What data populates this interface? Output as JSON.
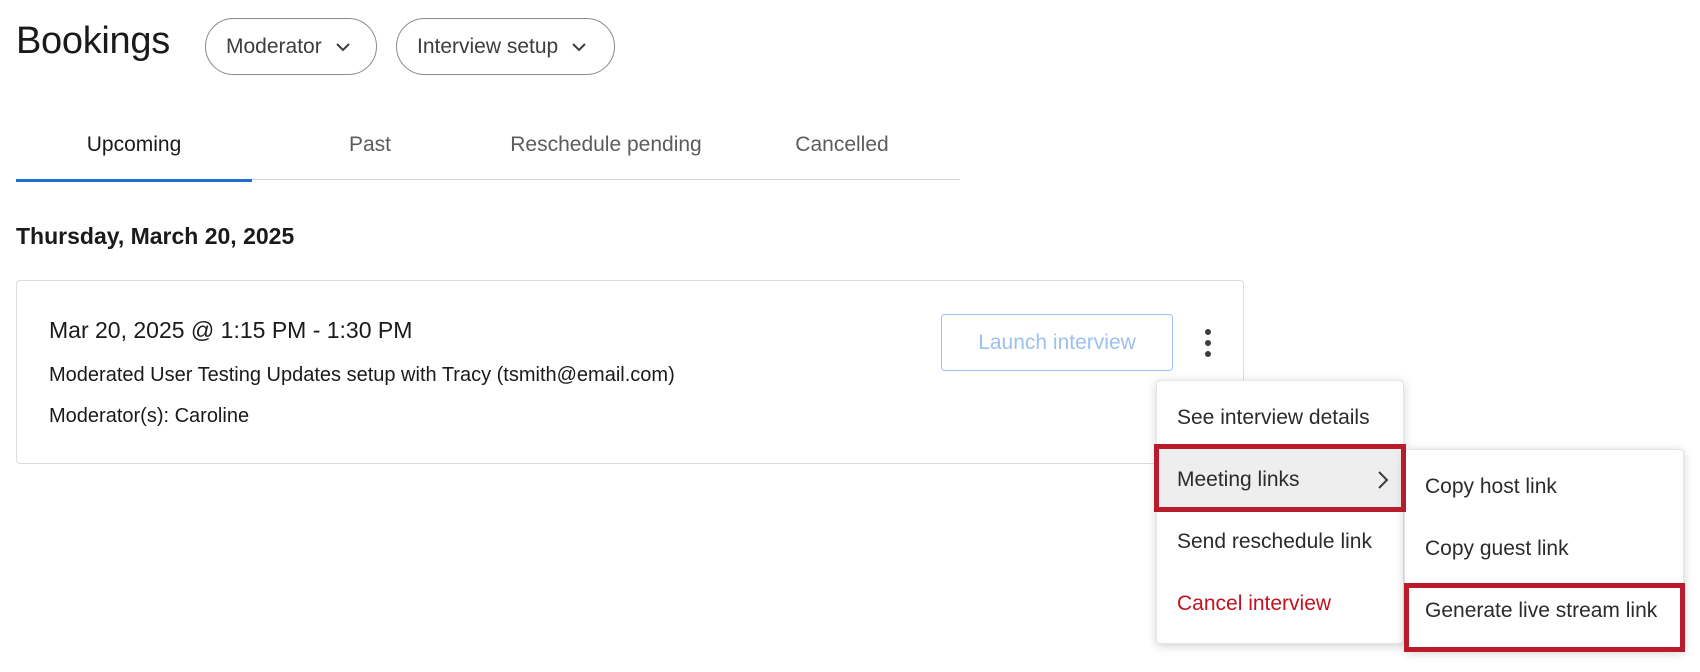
{
  "page": {
    "title": "Bookings"
  },
  "filters": [
    {
      "label": "Moderator",
      "icon": "chevron-down-icon"
    },
    {
      "label": "Interview setup",
      "icon": "chevron-down-icon"
    }
  ],
  "tabs": [
    {
      "label": "Upcoming",
      "active": true
    },
    {
      "label": "Past",
      "active": false
    },
    {
      "label": "Reschedule pending",
      "active": false
    },
    {
      "label": "Cancelled",
      "active": false
    }
  ],
  "date_heading": "Thursday, March 20, 2025",
  "booking": {
    "time": "Mar 20, 2025 @ 1:15 PM - 1:30 PM",
    "description": "Moderated User Testing Updates setup with Tracy (tsmith@email.com)",
    "moderators": "Moderator(s): Caroline",
    "launch_label": "Launch interview"
  },
  "actions_menu": {
    "items": [
      {
        "label": "See interview details"
      },
      {
        "label": "Meeting links",
        "has_submenu": true
      },
      {
        "label": "Send reschedule link"
      },
      {
        "label": "Cancel interview",
        "color": "#c2121f"
      }
    ]
  },
  "meeting_links_submenu": {
    "items": [
      {
        "label": "Copy host link"
      },
      {
        "label": "Copy guest link"
      },
      {
        "label": "Generate live stream link"
      }
    ]
  },
  "colors": {
    "accent": "#1d6fd1",
    "danger": "#c2121f",
    "highlight": "#b81c2c",
    "launch_disabled": "#9cc1ee"
  }
}
